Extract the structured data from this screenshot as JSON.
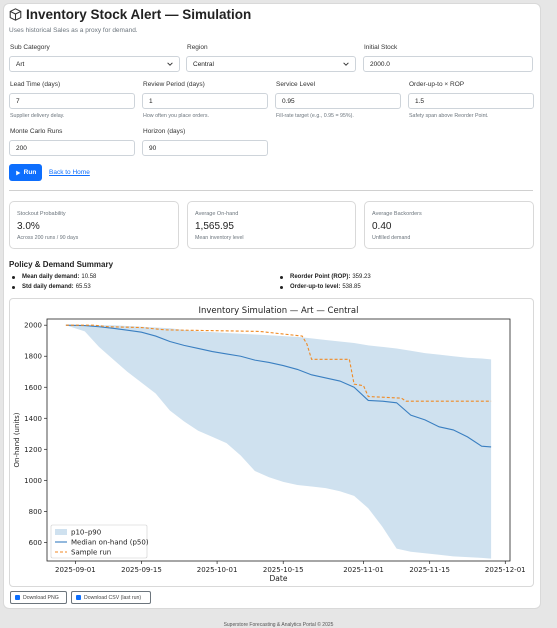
{
  "header": {
    "title": "Inventory Stock Alert — Simulation",
    "subtitle": "Uses historical Sales as a proxy for demand."
  },
  "form": {
    "sub_category": {
      "label": "Sub Category",
      "value": "Art"
    },
    "region": {
      "label": "Region",
      "value": "Central"
    },
    "initial_stock": {
      "label": "Initial Stock",
      "value": "2000.0"
    },
    "lead_time": {
      "label": "Lead Time (days)",
      "value": "7",
      "help": "Supplier delivery delay."
    },
    "review_period": {
      "label": "Review Period (days)",
      "value": "1",
      "help": "How often you place orders."
    },
    "service_level": {
      "label": "Service Level",
      "value": "0.95",
      "help": "Fill-rate target (e.g., 0.95 = 95%)."
    },
    "order_up_to": {
      "label": "Order-up-to × ROP",
      "value": "1.5",
      "help": "Safety span above Reorder Point."
    },
    "mc_runs": {
      "label": "Monte Carlo Runs",
      "value": "200"
    },
    "horizon": {
      "label": "Horizon (days)",
      "value": "90"
    },
    "run_label": "Run",
    "back_label": "Back to Home"
  },
  "stats": [
    {
      "label": "Stockout Probability",
      "value": "3.0%",
      "hint": "Across 200 runs / 90 days"
    },
    {
      "label": "Average On-hand",
      "value": "1,565.95",
      "hint": "Mean inventory level"
    },
    {
      "label": "Average Backorders",
      "value": "0.40",
      "hint": "Unfilled demand"
    }
  ],
  "summary": {
    "heading": "Policy & Demand Summary",
    "mean_label": "Mean daily demand:",
    "mean_value": "10.58",
    "std_label": "Std daily demand:",
    "std_value": "65.53",
    "rop_label": "Reorder Point (ROP):",
    "rop_value": "359.23",
    "out_label": "Order-up-to level:",
    "out_value": "538.85"
  },
  "chart_data": {
    "type": "line",
    "title": "Inventory Simulation — Art — Central",
    "xlabel": "Date",
    "ylabel": "On-hand (units)",
    "x_range": [
      "2025-08-26",
      "2025-12-02"
    ],
    "ylim": [
      480,
      2040
    ],
    "y_ticks": [
      600,
      800,
      1000,
      1200,
      1400,
      1600,
      1800,
      2000
    ],
    "x_ticks": [
      "2025-09-01",
      "2025-09-15",
      "2025-10-01",
      "2025-10-15",
      "2025-11-01",
      "2025-11-15",
      "2025-12-01"
    ],
    "legend_position": "lower-left",
    "colors": {
      "band": "#cfe1ef",
      "median": "#3a7fc1",
      "sample": "#f08a24"
    },
    "series": [
      {
        "name": "p10–p90",
        "kind": "band",
        "dates": [
          "2025-08-30",
          "2025-09-03",
          "2025-09-06",
          "2025-09-09",
          "2025-09-12",
          "2025-09-15",
          "2025-09-18",
          "2025-09-21",
          "2025-09-24",
          "2025-09-27",
          "2025-09-30",
          "2025-10-03",
          "2025-10-06",
          "2025-10-09",
          "2025-10-12",
          "2025-10-15",
          "2025-10-18",
          "2025-10-21",
          "2025-10-24",
          "2025-10-27",
          "2025-10-30",
          "2025-11-02",
          "2025-11-05",
          "2025-11-08",
          "2025-11-11",
          "2025-11-14",
          "2025-11-17",
          "2025-11-20",
          "2025-11-23",
          "2025-11-26",
          "2025-11-28"
        ],
        "upper": [
          2000,
          2000,
          2000,
          2000,
          1995,
          1990,
          1985,
          1980,
          1970,
          1960,
          1955,
          1950,
          1945,
          1940,
          1935,
          1930,
          1925,
          1915,
          1905,
          1895,
          1885,
          1870,
          1860,
          1850,
          1835,
          1820,
          1810,
          1800,
          1790,
          1785,
          1780
        ],
        "lower": [
          2000,
          1960,
          1860,
          1780,
          1700,
          1630,
          1560,
          1450,
          1380,
          1320,
          1280,
          1240,
          1160,
          1060,
          1020,
          990,
          970,
          960,
          950,
          930,
          900,
          820,
          700,
          560,
          540,
          530,
          520,
          510,
          505,
          500,
          495
        ]
      },
      {
        "name": "Median on-hand (p50)",
        "dates": [
          "2025-08-30",
          "2025-09-03",
          "2025-09-06",
          "2025-09-09",
          "2025-09-12",
          "2025-09-15",
          "2025-09-18",
          "2025-09-21",
          "2025-09-24",
          "2025-09-27",
          "2025-09-30",
          "2025-10-03",
          "2025-10-06",
          "2025-10-09",
          "2025-10-12",
          "2025-10-15",
          "2025-10-18",
          "2025-10-21",
          "2025-10-24",
          "2025-10-27",
          "2025-10-30",
          "2025-11-02",
          "2025-11-05",
          "2025-11-08",
          "2025-11-11",
          "2025-11-14",
          "2025-11-17",
          "2025-11-20",
          "2025-11-23",
          "2025-11-26",
          "2025-11-28"
        ],
        "values": [
          2000,
          1998,
          1990,
          1980,
          1968,
          1955,
          1930,
          1895,
          1870,
          1850,
          1830,
          1815,
          1800,
          1775,
          1760,
          1740,
          1715,
          1680,
          1660,
          1640,
          1600,
          1515,
          1510,
          1500,
          1420,
          1390,
          1345,
          1325,
          1280,
          1220,
          1215
        ]
      },
      {
        "name": "Sample run",
        "dates": [
          "2025-08-30",
          "2025-09-05",
          "2025-09-08",
          "2025-09-15",
          "2025-09-20",
          "2025-10-10",
          "2025-10-19",
          "2025-10-20",
          "2025-10-21",
          "2025-10-29",
          "2025-10-30",
          "2025-11-01",
          "2025-11-02",
          "2025-11-09",
          "2025-11-10",
          "2025-11-28"
        ],
        "values": [
          2000,
          2000,
          1990,
          1985,
          1970,
          1960,
          1930,
          1880,
          1780,
          1780,
          1620,
          1610,
          1540,
          1530,
          1510,
          1510
        ]
      }
    ]
  },
  "downloads": {
    "png_label": "Download PNG",
    "csv_label": "Download CSV (last run)"
  },
  "footer": "Superstore Forecasting & Analytics Portal © 2025"
}
